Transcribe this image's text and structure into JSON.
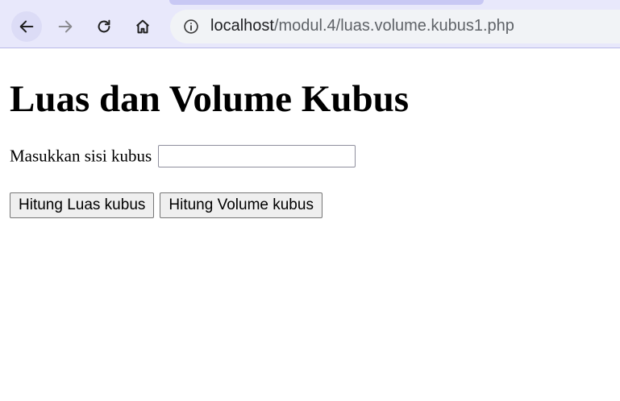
{
  "browser": {
    "url_host": "localhost",
    "url_path": "/modul.4/luas.volume.kubus1.php",
    "icons": {
      "back": "back-arrow-icon",
      "forward": "forward-arrow-icon",
      "reload": "reload-icon",
      "home": "home-icon",
      "info": "info-icon"
    }
  },
  "page": {
    "heading": "Luas dan Volume Kubus",
    "side_label": "Masukkan sisi kubus",
    "side_value": "",
    "btn_luas": "Hitung Luas kubus",
    "btn_volume": "Hitung Volume kubus"
  }
}
